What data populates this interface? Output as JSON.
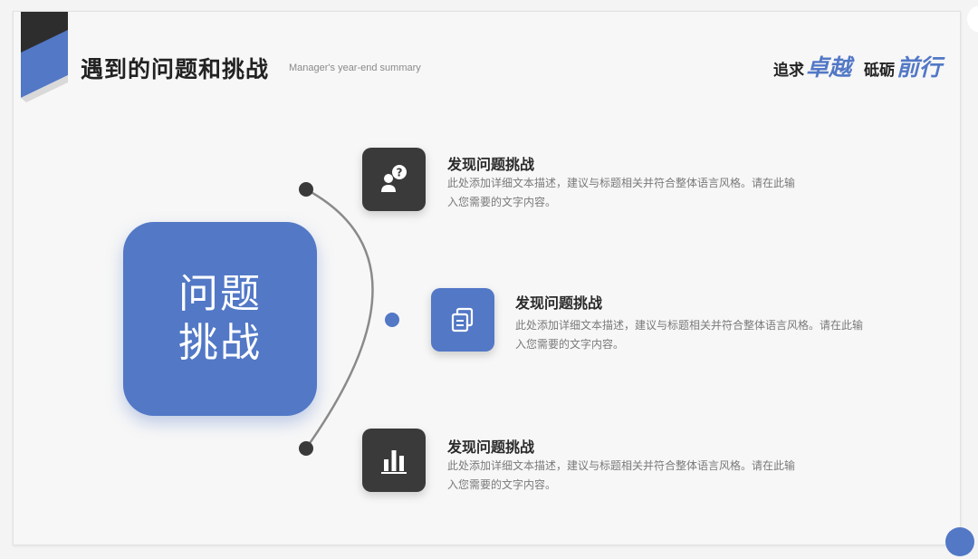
{
  "header": {
    "title": "遇到的问题和挑战",
    "subtitle": "Manager's year-end summary",
    "slogan": [
      {
        "plain": "追求",
        "accent": "卓越"
      },
      {
        "plain": "砥砺",
        "accent": "前行"
      }
    ]
  },
  "hero": {
    "line1": "问题",
    "line2": "挑战"
  },
  "items": [
    {
      "icon": "user-question-icon",
      "title": "发现问题挑战",
      "desc": "此处添加详细文本描述，建议与标题相关并符合整体语言风格。请在此输入您需要的文字内容。"
    },
    {
      "icon": "copy-document-icon",
      "title": "发现问题挑战",
      "desc": "此处添加详细文本描述，建议与标题相关并符合整体语言风格。请在此输入您需要的文字内容。"
    },
    {
      "icon": "bar-chart-icon",
      "title": "发现问题挑战",
      "desc": "此处添加详细文本描述，建议与标题相关并符合整体语言风格。请在此输入您需要的文字内容。"
    }
  ],
  "colors": {
    "accent": "#5278c6",
    "dark": "#3a3a3a"
  }
}
